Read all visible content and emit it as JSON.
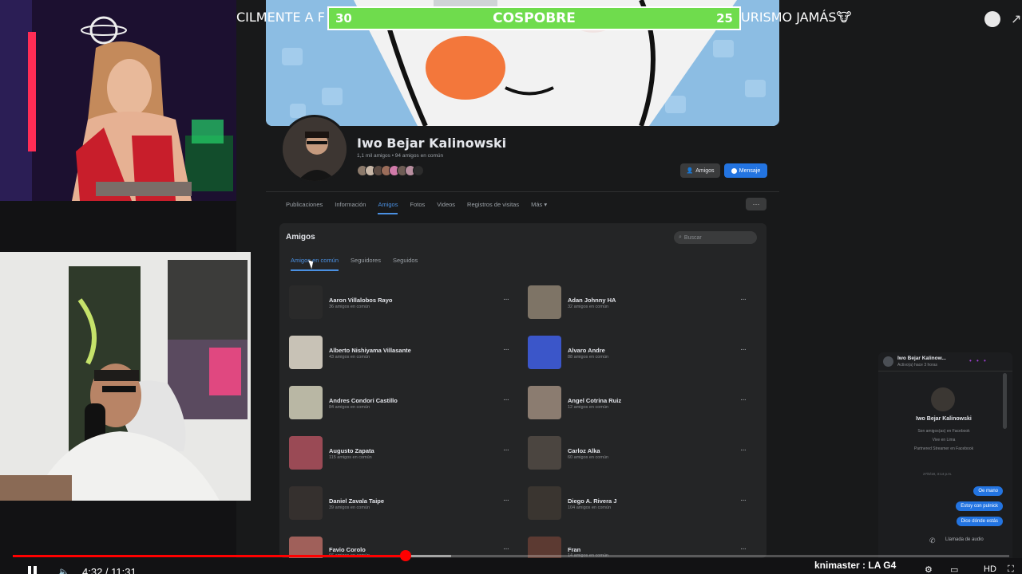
{
  "overlay": {
    "ticker_left": "CILMENTE A F",
    "ticker_right": "URISMO JAMÁS🐮",
    "vote_bar": {
      "title": "COSPOBRE",
      "left_count": "30",
      "right_count": "25"
    }
  },
  "profile": {
    "name": "Iwo Bejar Kalinowski",
    "subtitle": "1,1 mil amigos • 94 amigos en común",
    "friends_button": "Amigos",
    "message_button": "Mensaje",
    "tabs": [
      "Publicaciones",
      "Información",
      "Amigos",
      "Fotos",
      "Videos",
      "Registros de visitas",
      "Más ▾"
    ],
    "active_tab": "Amigos",
    "more_button": "···"
  },
  "friends": {
    "title": "Amigos",
    "search_placeholder": "Buscar",
    "subtabs": [
      "Amigos en común",
      "Seguidores",
      "Seguidos"
    ],
    "active_subtab": "Amigos en común",
    "list": [
      {
        "name": "Aaron Villalobos Rayo",
        "mutual": "36 amigos en común"
      },
      {
        "name": "Adan Johnny HA",
        "mutual": "32 amigos en común"
      },
      {
        "name": "Alberto Nishiyama Villasante",
        "mutual": "43 amigos en común"
      },
      {
        "name": "Alvaro Andre",
        "mutual": "88 amigos en común"
      },
      {
        "name": "Andres Condori Castillo",
        "mutual": "84 amigos en común"
      },
      {
        "name": "Angel Cotrina Ruiz",
        "mutual": "12 amigos en común"
      },
      {
        "name": "Augusto Zapata",
        "mutual": "115 amigos en común"
      },
      {
        "name": "Carloz Alka",
        "mutual": "60 amigos en común"
      },
      {
        "name": "Daniel Zavala Taipe",
        "mutual": "39 amigos en común"
      },
      {
        "name": "Diego A. Rivera J",
        "mutual": "104 amigos en común"
      },
      {
        "name": "Favio Corolo",
        "mutual": "66 amigos en común"
      },
      {
        "name": "Fran",
        "mutual": "14 amigos en común"
      }
    ],
    "more_label": "···"
  },
  "chat": {
    "header_name": "Iwo Bejar Kalinow...",
    "header_status": "Activo(a) hace 3 horas",
    "header_controls": "• • •",
    "name": "Iwo Bejar Kalinowski",
    "info": [
      "Son amigos(as) en Facebook",
      "Vive en Lima",
      "Partnered Streamer en Facebook"
    ],
    "timestamp": "27/6/18, 3:14 p.m.",
    "messages": [
      "Oe mano",
      "Estoy con pulnick",
      "Dice dónde estás"
    ],
    "input_label": "Llamada de audio"
  },
  "player": {
    "time": "4:32 / 11:31",
    "progress": 0.394,
    "buffered": 0.44,
    "chat_message": "knimaster : LA G4"
  },
  "colors": {
    "accent_blue": "#2374e1",
    "vote_green": "#6fdc4d",
    "progress_red": "#ff0000"
  }
}
